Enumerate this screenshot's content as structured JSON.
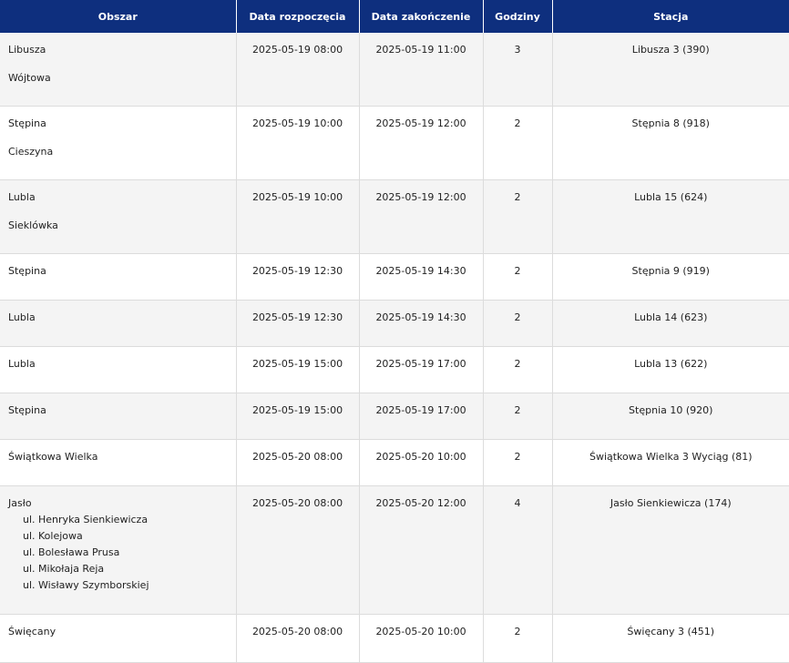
{
  "headers": [
    "Obszar",
    "Data rozpoczęcia",
    "Data zakończenie",
    "Godziny",
    "Stacja"
  ],
  "rows": [
    {
      "areas": [
        "Libusza",
        "Wójtowa"
      ],
      "start": "2025-05-19 08:00",
      "end": "2025-05-19 11:00",
      "hours": "3",
      "station": "Libusza 3 (390)"
    },
    {
      "areas": [
        "Stępina",
        "Cieszyna"
      ],
      "start": "2025-05-19 10:00",
      "end": "2025-05-19 12:00",
      "hours": "2",
      "station": "Stępnia 8 (918)"
    },
    {
      "areas": [
        "Lubla",
        "Sieklówka"
      ],
      "start": "2025-05-19 10:00",
      "end": "2025-05-19 12:00",
      "hours": "2",
      "station": "Lubla 15 (624)"
    },
    {
      "areas": [
        "Stępina"
      ],
      "start": "2025-05-19 12:30",
      "end": "2025-05-19 14:30",
      "hours": "2",
      "station": "Stępnia 9 (919)"
    },
    {
      "areas": [
        "Lubla"
      ],
      "start": "2025-05-19 12:30",
      "end": "2025-05-19 14:30",
      "hours": "2",
      "station": "Lubla 14 (623)"
    },
    {
      "areas": [
        "Lubla"
      ],
      "start": "2025-05-19 15:00",
      "end": "2025-05-19 17:00",
      "hours": "2",
      "station": "Lubla 13 (622)"
    },
    {
      "areas": [
        "Stępina"
      ],
      "start": "2025-05-19 15:00",
      "end": "2025-05-19 17:00",
      "hours": "2",
      "station": "Stępnia 10 (920)"
    },
    {
      "areas": [
        "Świątkowa Wielka"
      ],
      "start": "2025-05-20 08:00",
      "end": "2025-05-20 10:00",
      "hours": "2",
      "station": "Świątkowa Wielka 3 Wyciąg (81)"
    },
    {
      "areas": [
        "Jasło"
      ],
      "streets": [
        "ul. Henryka Sienkiewicza",
        "ul. Kolejowa",
        "ul. Bolesława Prusa",
        "ul. Mikołaja Reja",
        "ul. Wisławy Szymborskiej"
      ],
      "start": "2025-05-20 08:00",
      "end": "2025-05-20 12:00",
      "hours": "4",
      "station": "Jasło Sienkiewicza (174)"
    },
    {
      "areas": [
        "Święcany"
      ],
      "start": "2025-05-20 08:00",
      "end": "2025-05-20 10:00",
      "hours": "2",
      "station": "Święcany 3 (451)"
    }
  ]
}
